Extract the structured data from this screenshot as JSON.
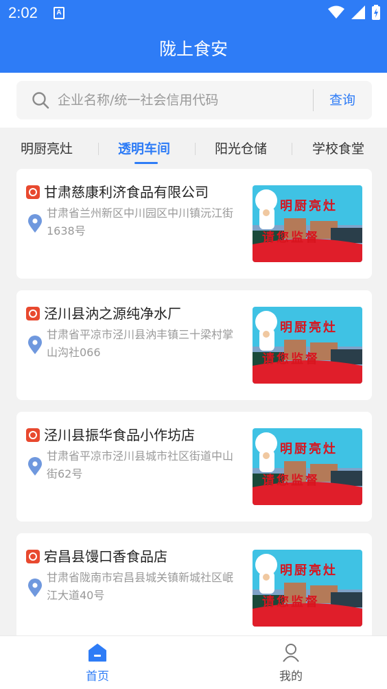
{
  "status": {
    "time": "2:02",
    "indicator": "A"
  },
  "header": {
    "title": "陇上食安"
  },
  "search": {
    "placeholder": "企业名称/统一社会信用代码",
    "button_label": "查询"
  },
  "tabs": [
    {
      "label": "明厨亮灶",
      "active": false
    },
    {
      "label": "透明车间",
      "active": true
    },
    {
      "label": "阳光仓储",
      "active": false
    },
    {
      "label": "学校食堂",
      "active": false
    }
  ],
  "cards": [
    {
      "name": "甘肃慈康利济食品有限公司",
      "address": "甘肃省兰州新区中川园区中川镇沅江街1638号",
      "thumb_text_top": "明厨亮灶",
      "thumb_text_bottom": "请您监督"
    },
    {
      "name": "泾川县汭之源纯净水厂",
      "address": "甘肃省平凉市泾川县汭丰镇三十梁村掌山沟社066",
      "thumb_text_top": "明厨亮灶",
      "thumb_text_bottom": "请您监督"
    },
    {
      "name": "泾川县振华食品小作坊店",
      "address": "甘肃省平凉市泾川县城市社区街道中山街62号",
      "thumb_text_top": "明厨亮灶",
      "thumb_text_bottom": "请您监督"
    },
    {
      "name": "宕昌县馒口香食品店",
      "address": "甘肃省陇南市宕昌县城关镇新城社区岷江大道40号",
      "thumb_text_top": "明厨亮灶",
      "thumb_text_bottom": "请您监督"
    }
  ],
  "bottom_nav": [
    {
      "label": "首页",
      "icon": "home-icon",
      "active": true
    },
    {
      "label": "我的",
      "icon": "user-icon",
      "active": false
    }
  ],
  "colors": {
    "primary": "#2e7cf6",
    "badge": "#e8492f",
    "pin": "#6f98de"
  }
}
